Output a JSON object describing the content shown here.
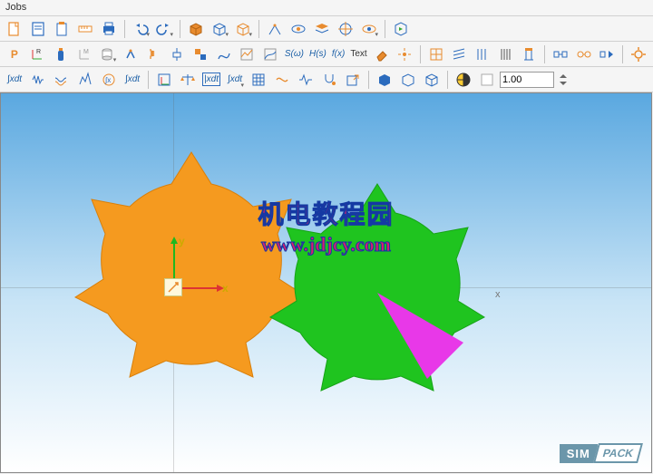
{
  "menu": {
    "jobs": "Jobs"
  },
  "labels": {
    "sw": "S(ω)",
    "hs": "H(s)",
    "fx": "f(x)",
    "text": "Text",
    "jxdt1": "∫xdt",
    "jxdt2": "|xdt",
    "jxdt3": "∫xdt",
    "y": "y",
    "x": "x",
    "marker": "x"
  },
  "input": {
    "scale": "1.00"
  },
  "watermark": {
    "cn": "机电教程园",
    "url": "www.jdjcy.com"
  },
  "logo": {
    "sim": "SIM",
    "pack": "PACK"
  }
}
